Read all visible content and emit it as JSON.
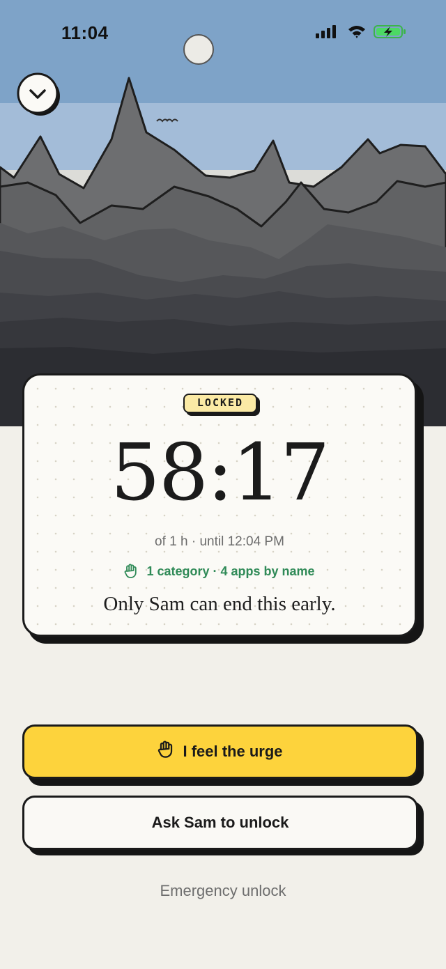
{
  "status_bar": {
    "time": "11:04",
    "icons": [
      "cellular-signal-icon",
      "wifi-icon",
      "battery-charging-icon"
    ],
    "battery_color": "#4cd964"
  },
  "header": {
    "collapse_icon": "chevron-down-icon"
  },
  "lock_card": {
    "badge": "LOCKED",
    "badge_color": "#fbeaa5",
    "timer": "58:17",
    "duration_line": "of 1 h · until 12:04 PM",
    "scope_icon": "hand-icon",
    "scope_text": "1 category · 4 apps by name",
    "scope_color": "#2f8a57",
    "note": "Only Sam can end this early."
  },
  "actions": {
    "urge_icon": "hand-icon",
    "urge_label": "I feel the urge",
    "urge_color": "#fdd33c",
    "ask_label": "Ask Sam to unlock",
    "emergency_label": "Emergency unlock"
  }
}
